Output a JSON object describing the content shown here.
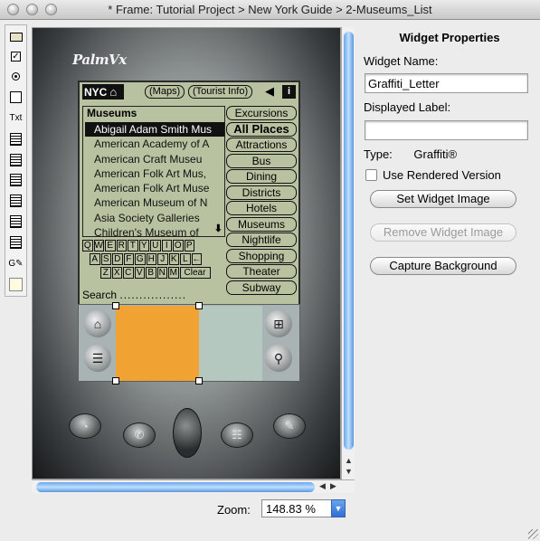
{
  "window": {
    "title": "* Frame: Tutorial Project > New York Guide > 2-Museums_List"
  },
  "palette": {
    "tools": [
      {
        "name": "label",
        "icon": "label-tool-icon"
      },
      {
        "name": "checkbox",
        "icon": "checkbox-tool-icon",
        "glyph": "✓"
      },
      {
        "name": "radio",
        "icon": "radio-tool-icon"
      },
      {
        "name": "field",
        "icon": "field-tool-icon"
      },
      {
        "name": "text",
        "icon": "text-tool-icon",
        "glyph": "Txt"
      },
      {
        "name": "list",
        "icon": "list-tool-icon"
      },
      {
        "name": "table",
        "icon": "table-tool-icon"
      },
      {
        "name": "popup",
        "icon": "popup-tool-icon"
      },
      {
        "name": "scrollbar",
        "icon": "scrollbar-tool-icon"
      },
      {
        "name": "gadget",
        "icon": "gadget-tool-icon"
      },
      {
        "name": "slider",
        "icon": "slider-tool-icon"
      },
      {
        "name": "graffiti",
        "icon": "graffiti-tool-icon",
        "glyph": "G✎"
      },
      {
        "name": "bitmap",
        "icon": "bitmap-tool-icon"
      }
    ]
  },
  "device": {
    "brand": "PalmVx",
    "screen": {
      "nyc": "NYC",
      "maps": "(Maps)",
      "tourist_info": "(Tourist Info)",
      "info_glyph": "i",
      "list_title": "Museums",
      "list_items": [
        "Abigail Adam Smith Mus",
        "American Academy of A",
        "American Craft Museu",
        "American Folk Art Mus,",
        "American Folk Art Muse",
        "American Museum of N",
        "Asia Society Galleries",
        "Children's Museum of"
      ],
      "selected_index": 0,
      "categories": [
        "Excursions",
        "All Places",
        "Attractions",
        "Bus",
        "Dining",
        "Districts",
        "Hotels",
        "Museums",
        "Nightlife",
        "Shopping",
        "Theater",
        "Subway"
      ],
      "keyboard_rows": [
        [
          "Q",
          "W",
          "E",
          "R",
          "T",
          "Y",
          "U",
          "I",
          "O",
          "P"
        ],
        [
          "A",
          "S",
          "D",
          "F",
          "G",
          "H",
          "J",
          "K",
          "L",
          "←"
        ],
        [
          "Z",
          "X",
          "C",
          "V",
          "B",
          "N",
          "M",
          "Clear"
        ]
      ],
      "search_label": "Search",
      "search_dots": "................."
    }
  },
  "zoom": {
    "label": "Zoom:",
    "value": "148.83 %"
  },
  "properties": {
    "title": "Widget Properties",
    "widget_name_label": "Widget Name:",
    "widget_name_value": "Graffiti_Letter",
    "displayed_label_label": "Displayed Label:",
    "displayed_label_value": "",
    "type_label": "Type:",
    "type_value": "Graffiti®",
    "use_rendered_label": "Use Rendered Version",
    "use_rendered_checked": false,
    "set_image_button": "Set Widget Image",
    "remove_image_button": "Remove Widget Image",
    "capture_bg_button": "Capture Background"
  },
  "colors": {
    "graffiti_selection": "#f0a232",
    "scroll_thumb": "#6da6e8",
    "screen_bg": "#b8c2a0"
  }
}
